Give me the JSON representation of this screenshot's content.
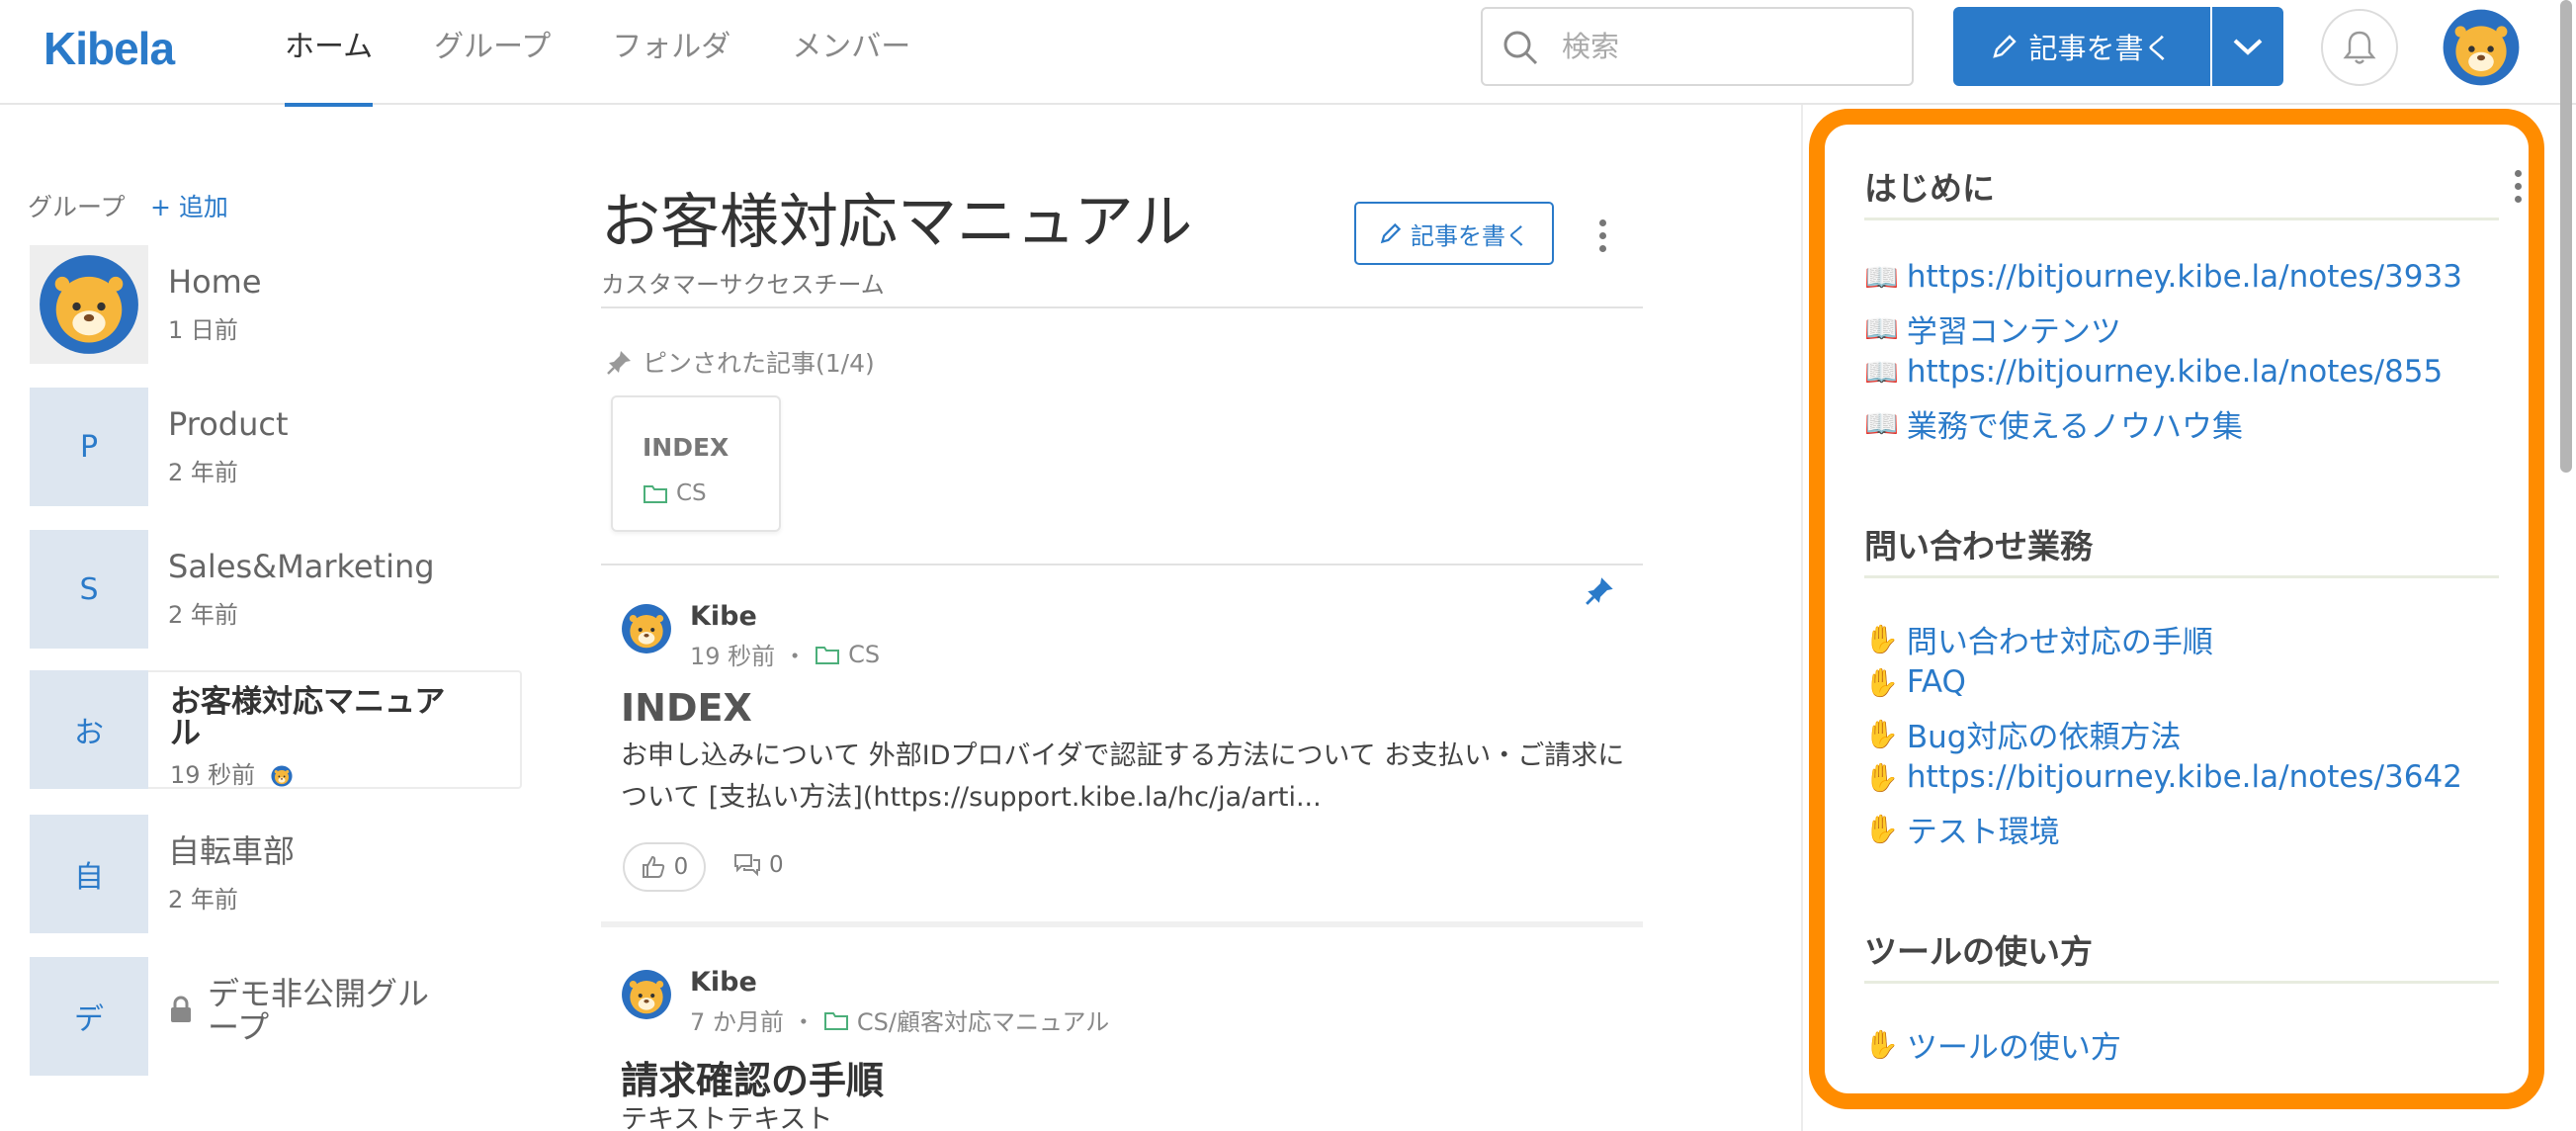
{
  "header": {
    "logo": "Kibela",
    "nav": [
      "ホーム",
      "グループ",
      "フォルダ",
      "メンバー"
    ],
    "search_placeholder": "検索",
    "write_label": "記事を書く"
  },
  "sidebar": {
    "title": "グループ",
    "add_label": "+ 追加",
    "groups": [
      {
        "thumb": "",
        "name": "Home",
        "time": "1 日前"
      },
      {
        "thumb": "P",
        "name": "Product",
        "time": "2 年前"
      },
      {
        "thumb": "S",
        "name": "Sales&Marketing",
        "time": "2 年前"
      },
      {
        "thumb": "お",
        "name": "お客様対応マニュアル",
        "time": "19 秒前"
      },
      {
        "thumb": "自",
        "name": "自転車部",
        "time": "2 年前"
      },
      {
        "thumb": "デ",
        "name": "デモ非公開グループ",
        "time": ""
      }
    ]
  },
  "main": {
    "title": "お客様対応マニュアル",
    "subtitle": "カスタマーサクセスチーム",
    "write_label": "記事を書く",
    "pinned_label": "ピンされた記事(1/4)",
    "pinned_card": {
      "title": "INDEX",
      "folder": "CS"
    },
    "posts": [
      {
        "author": "Kibe",
        "time": "19 秒前",
        "folder": "CS",
        "title": "INDEX",
        "body": "お申し込みについて 外部IDプロバイダで認証する方法について お支払い・ご請求について [支払い方法](https://support.kibe.la/hc/ja/arti...",
        "likes": "0",
        "comments": "0"
      },
      {
        "author": "Kibe",
        "time": "7 か月前",
        "folder": "CS/顧客対応マニュアル",
        "title": "請求確認の手順",
        "body": "テキストテキスト"
      }
    ]
  },
  "right_panel": {
    "sections": [
      {
        "title": "はじめに",
        "links": [
          {
            "emoji": "📖",
            "text": "https://bitjourney.kibe.la/notes/3933"
          },
          {
            "emoji": "📖",
            "text": "学習コンテンツ"
          },
          {
            "emoji": "📖",
            "text": "https://bitjourney.kibe.la/notes/855"
          },
          {
            "emoji": "📖",
            "text": "業務で使えるノウハウ集"
          }
        ]
      },
      {
        "title": "問い合わせ業務",
        "links": [
          {
            "emoji": "✋",
            "text": "問い合わせ対応の手順"
          },
          {
            "emoji": "✋",
            "text": "FAQ"
          },
          {
            "emoji": "✋",
            "text": "Bug対応の依頼方法"
          },
          {
            "emoji": "✋",
            "text": "https://bitjourney.kibe.la/notes/3642"
          },
          {
            "emoji": "✋",
            "text": "テスト環境"
          }
        ]
      },
      {
        "title": "ツールの使い方",
        "links": [
          {
            "emoji": "✋",
            "text": "ツールの使い方"
          }
        ]
      }
    ]
  },
  "colors": {
    "accent": "#2a7ac9",
    "highlight": "#ff8c00"
  }
}
